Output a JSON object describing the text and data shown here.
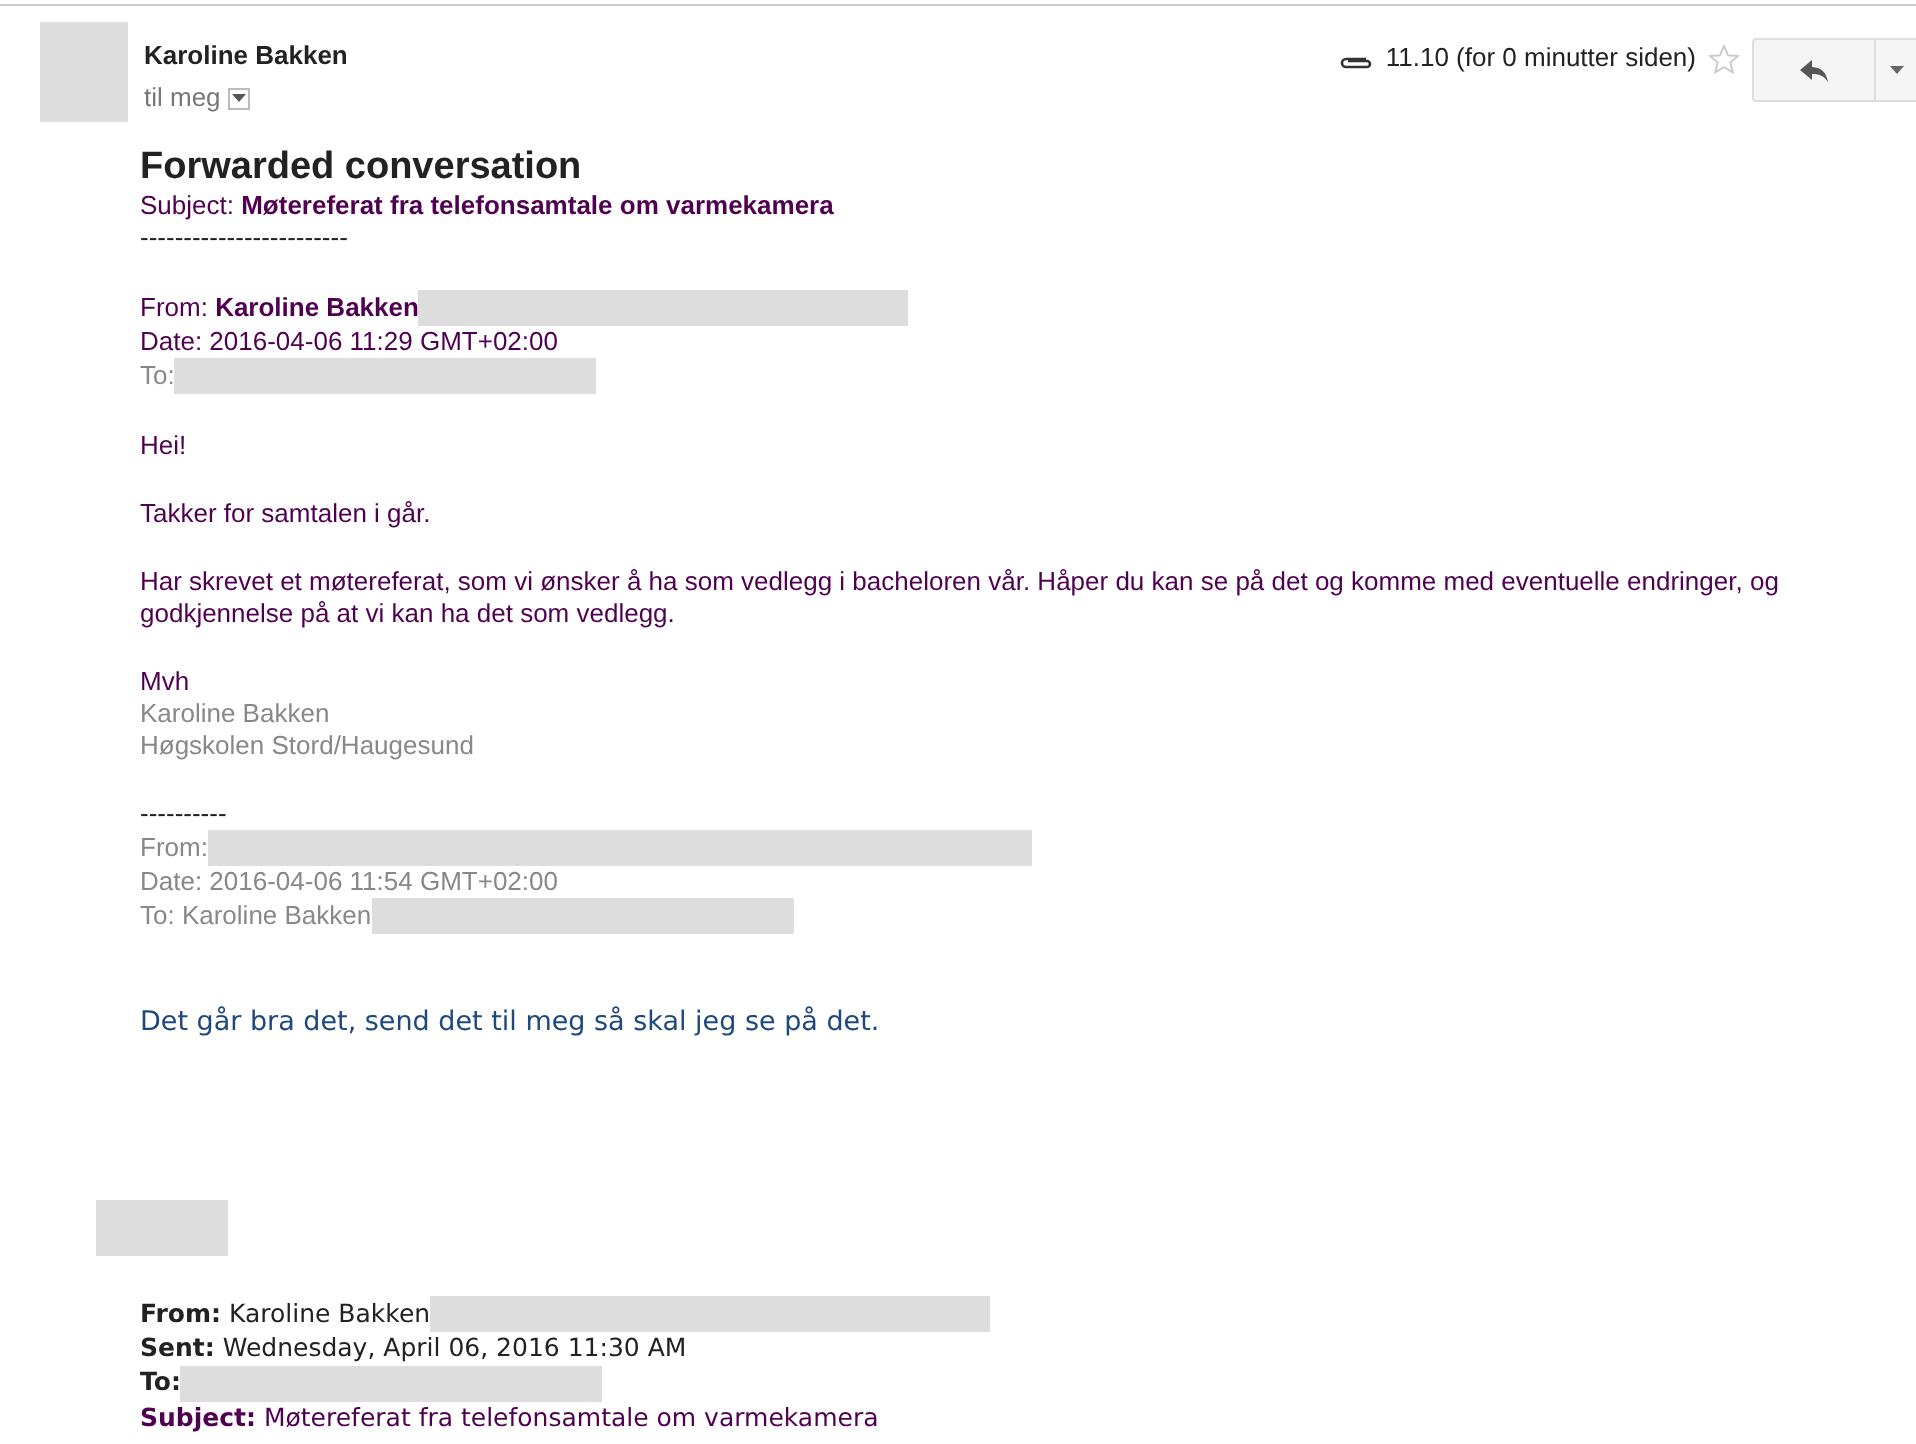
{
  "header": {
    "sender": "Karoline Bakken",
    "recipient": "til meg",
    "time": "11.10 (for 0 minutter siden)",
    "starred": false
  },
  "blocks": [
    {
      "kind": "heading",
      "lines": [
        {
          "text": "Forwarded conversation",
          "color": "#222222"
        }
      ]
    },
    {
      "kind": "text",
      "lines": [
        {
          "text": "Subject: **Møtereferat fra telefonsamtale om varmekamera**",
          "color": "#500050"
        },
        {
          "text": "------------------------",
          "color": "#222222"
        }
      ]
    },
    {
      "kind": "text",
      "lines": [
        {
          "text": "From: **Karoline Bakken**",
          "color": "#500050",
          "redacted": true
        },
        {
          "text": "Date: 2016-04-06 11:29 GMT+02:00",
          "color": "#500050"
        },
        {
          "text": "To:",
          "color": "#888888",
          "redacted": true
        }
      ]
    },
    {
      "kind": "text",
      "lines": [
        {
          "text": "Hei!",
          "color": "#500050"
        }
      ]
    },
    {
      "kind": "text",
      "lines": [
        {
          "text": "Takker for samtalen i går.",
          "color": "#500050"
        }
      ]
    },
    {
      "kind": "text",
      "lines": [
        {
          "text": "Har skrevet et møtereferat, som vi ønsker å ha som vedlegg i bacheloren vår. Håper du kan se på det og komme med eventuelle endringer, og godkjennelse på at vi kan ha det som vedlegg.",
          "color": "#500050"
        }
      ]
    },
    {
      "kind": "text",
      "lines": [
        {
          "text": "Mvh",
          "color": "#500050"
        },
        {
          "text": "Karoline Bakken",
          "color": "#888888"
        },
        {
          "text": "Høgskolen Stord/Haugesund",
          "color": "#888888"
        }
      ]
    },
    {
      "kind": "text",
      "lines": [
        {
          "text": "----------",
          "color": "#222222"
        },
        {
          "text": "From:",
          "color": "#888888",
          "redacted": true
        },
        {
          "text": "Date: 2016-04-06 11:54 GMT+02:00",
          "color": "#888888"
        },
        {
          "text": "To: Karoline Bakken",
          "color": "#888888",
          "redacted": true
        }
      ]
    },
    {
      "kind": "reply",
      "lines": [
        {
          "text": "Det går bra det, send det til meg så skal jeg se på det.",
          "color": "#1f497d"
        }
      ]
    },
    {
      "kind": "image"
    },
    {
      "kind": "outlook",
      "lines": [
        {
          "text": "**From:** Karoline Bakken",
          "color": "#222222",
          "redacted": true
        },
        {
          "text": "**Sent:** Wednesday, April 06, 2016 11:30 AM",
          "color": "#222222"
        },
        {
          "text": "**To:**",
          "color": "#222222",
          "redacted": true
        },
        {
          "text": "**Subject:** Møtereferat fra telefonsamtale om varmekamera",
          "color": "#500050"
        }
      ]
    }
  ]
}
